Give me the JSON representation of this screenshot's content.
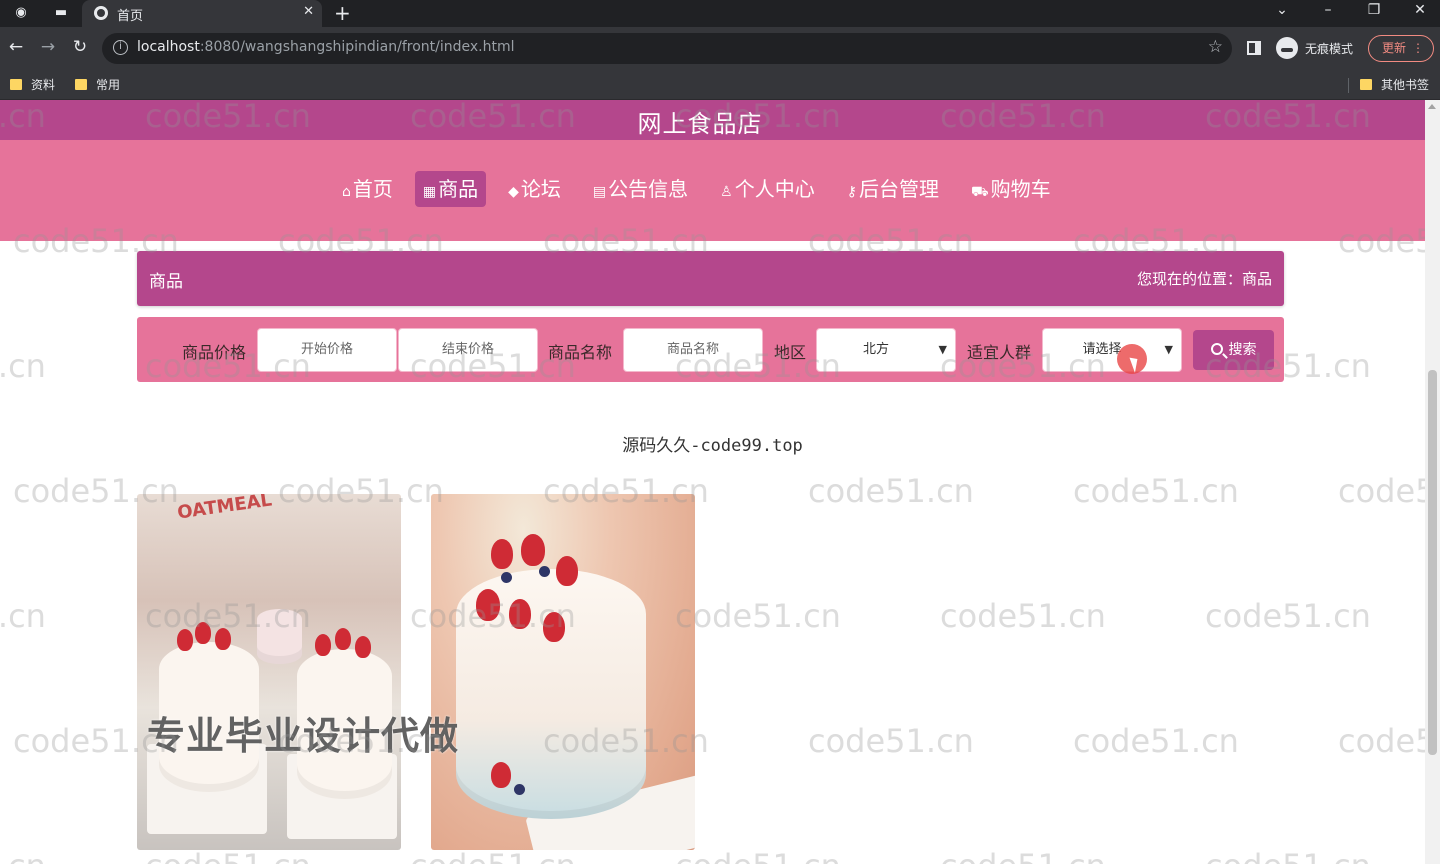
{
  "browser": {
    "tab_title": "首页",
    "url_host": "localhost",
    "url_rest": ":8080/wangshangshipindian/front/index.html",
    "incognito_label": "无痕模式",
    "update_label": "更新",
    "bookmarks": [
      "资料",
      "常用"
    ],
    "other_bookmarks": "其他书签"
  },
  "site": {
    "title": "网上食品店",
    "nav": [
      {
        "icon": "⌂",
        "label": "首页"
      },
      {
        "icon": "▦",
        "label": "商品"
      },
      {
        "icon": "◆",
        "label": "论坛"
      },
      {
        "icon": "▤",
        "label": "公告信息"
      },
      {
        "icon": "♙",
        "label": "个人中心"
      },
      {
        "icon": "⚷",
        "label": "后台管理"
      },
      {
        "icon": "⛟",
        "label": "购物车"
      }
    ],
    "active_nav": "商品"
  },
  "breadcrumb": {
    "title": "商品",
    "location": "您现在的位置：商品"
  },
  "filters": {
    "price_label": "商品价格",
    "price_min_placeholder": "开始价格",
    "price_max_placeholder": "结束价格",
    "name_label": "商品名称",
    "name_placeholder": "商品名称",
    "region_label": "地区",
    "region_value": "北方",
    "crowd_label": "适宜人群",
    "crowd_value": "请选择",
    "search_label": "搜索"
  },
  "sub_text": "源码久久-code99.top",
  "products": [
    {
      "image": "strawberry-mini-cakes"
    },
    {
      "image": "strawberry-cream-cake"
    }
  ],
  "overlay_ad": "专业毕业设计代做",
  "watermark": "code51.cn",
  "colors": {
    "header": "#b4478c",
    "nav": "#e6739a",
    "accent": "#b4478c"
  }
}
